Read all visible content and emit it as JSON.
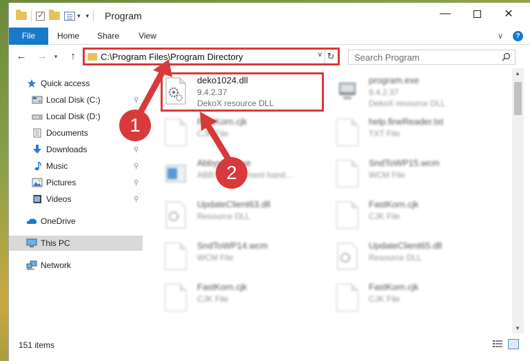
{
  "window": {
    "title": "Program",
    "minimize": "—",
    "close": "✕"
  },
  "ribbon": {
    "tabs": [
      "File",
      "Home",
      "Share",
      "View"
    ]
  },
  "address": {
    "path": "C:\\Program Files\\Program Directory",
    "refresh": "↻",
    "search_placeholder": "Search Program"
  },
  "nav": {
    "back": "←",
    "forward": "→",
    "up": "↑",
    "recent": "▾"
  },
  "sidebar": {
    "items": [
      {
        "label": "Quick access",
        "icon": "star-icon",
        "pinned": false
      },
      {
        "label": "Local Disk (C:)",
        "icon": "drive-icon",
        "pinned": true
      },
      {
        "label": "Local Disk (D:)",
        "icon": "drive-icon",
        "pinned": false
      },
      {
        "label": "Documents",
        "icon": "documents-icon",
        "pinned": true
      },
      {
        "label": "Downloads",
        "icon": "download-icon",
        "pinned": true
      },
      {
        "label": "Music",
        "icon": "music-icon",
        "pinned": true
      },
      {
        "label": "Pictures",
        "icon": "pictures-icon",
        "pinned": true
      },
      {
        "label": "Videos",
        "icon": "videos-icon",
        "pinned": true
      },
      {
        "label": "OneDrive",
        "icon": "cloud-icon",
        "pinned": false
      },
      {
        "label": "This PC",
        "icon": "computer-icon",
        "pinned": false
      },
      {
        "label": "Network",
        "icon": "network-icon",
        "pinned": false
      }
    ],
    "pin_glyph": "📌"
  },
  "files": [
    {
      "name": "deko1024.dll",
      "line2": "9.4.2.37",
      "line3": "DekoX resource DLL",
      "icon": "dll-gear-icon"
    },
    {
      "name": "program.exe",
      "line2": "9.4.2.37",
      "line3": "DekoX resource DLL",
      "icon": "exe-icon"
    },
    {
      "name": "FastKorn.cjk",
      "line2": "CJK File",
      "line3": "",
      "icon": "file-icon"
    },
    {
      "name": "help.fineReader.txt",
      "line2": "TXT File",
      "line3": "",
      "icon": "file-icon"
    },
    {
      "name": "AbbyyFR.exe",
      "line2": "ABBYY Document hand...",
      "line3": "",
      "icon": "app-window-icon"
    },
    {
      "name": "SndToWP15.wcm",
      "line2": "WCM File",
      "line3": "",
      "icon": "file-icon"
    },
    {
      "name": "UpdateClient63.dll",
      "line2": "Resource DLL",
      "line3": "",
      "icon": "dll-gear-icon"
    },
    {
      "name": "FastKorn.cjk",
      "line2": "CJK File",
      "line3": "",
      "icon": "file-icon"
    },
    {
      "name": "SndToWP14.wcm",
      "line2": "WCM File",
      "line3": "",
      "icon": "file-icon"
    },
    {
      "name": "UpdateClient65.dll",
      "line2": "Resource DLL",
      "line3": "",
      "icon": "dll-gear-icon"
    },
    {
      "name": "FastKorn.cjk",
      "line2": "CJK File",
      "line3": "",
      "icon": "file-icon"
    },
    {
      "name": "FastKorn.cjk",
      "line2": "CJK File",
      "line3": "",
      "icon": "file-icon"
    }
  ],
  "status": {
    "items_count": "151 items"
  },
  "annotations": {
    "badge1": "1",
    "badge2": "2",
    "color": "#d9393a"
  },
  "colors": {
    "accent": "#1979ca",
    "folder": "#e8c15a"
  }
}
